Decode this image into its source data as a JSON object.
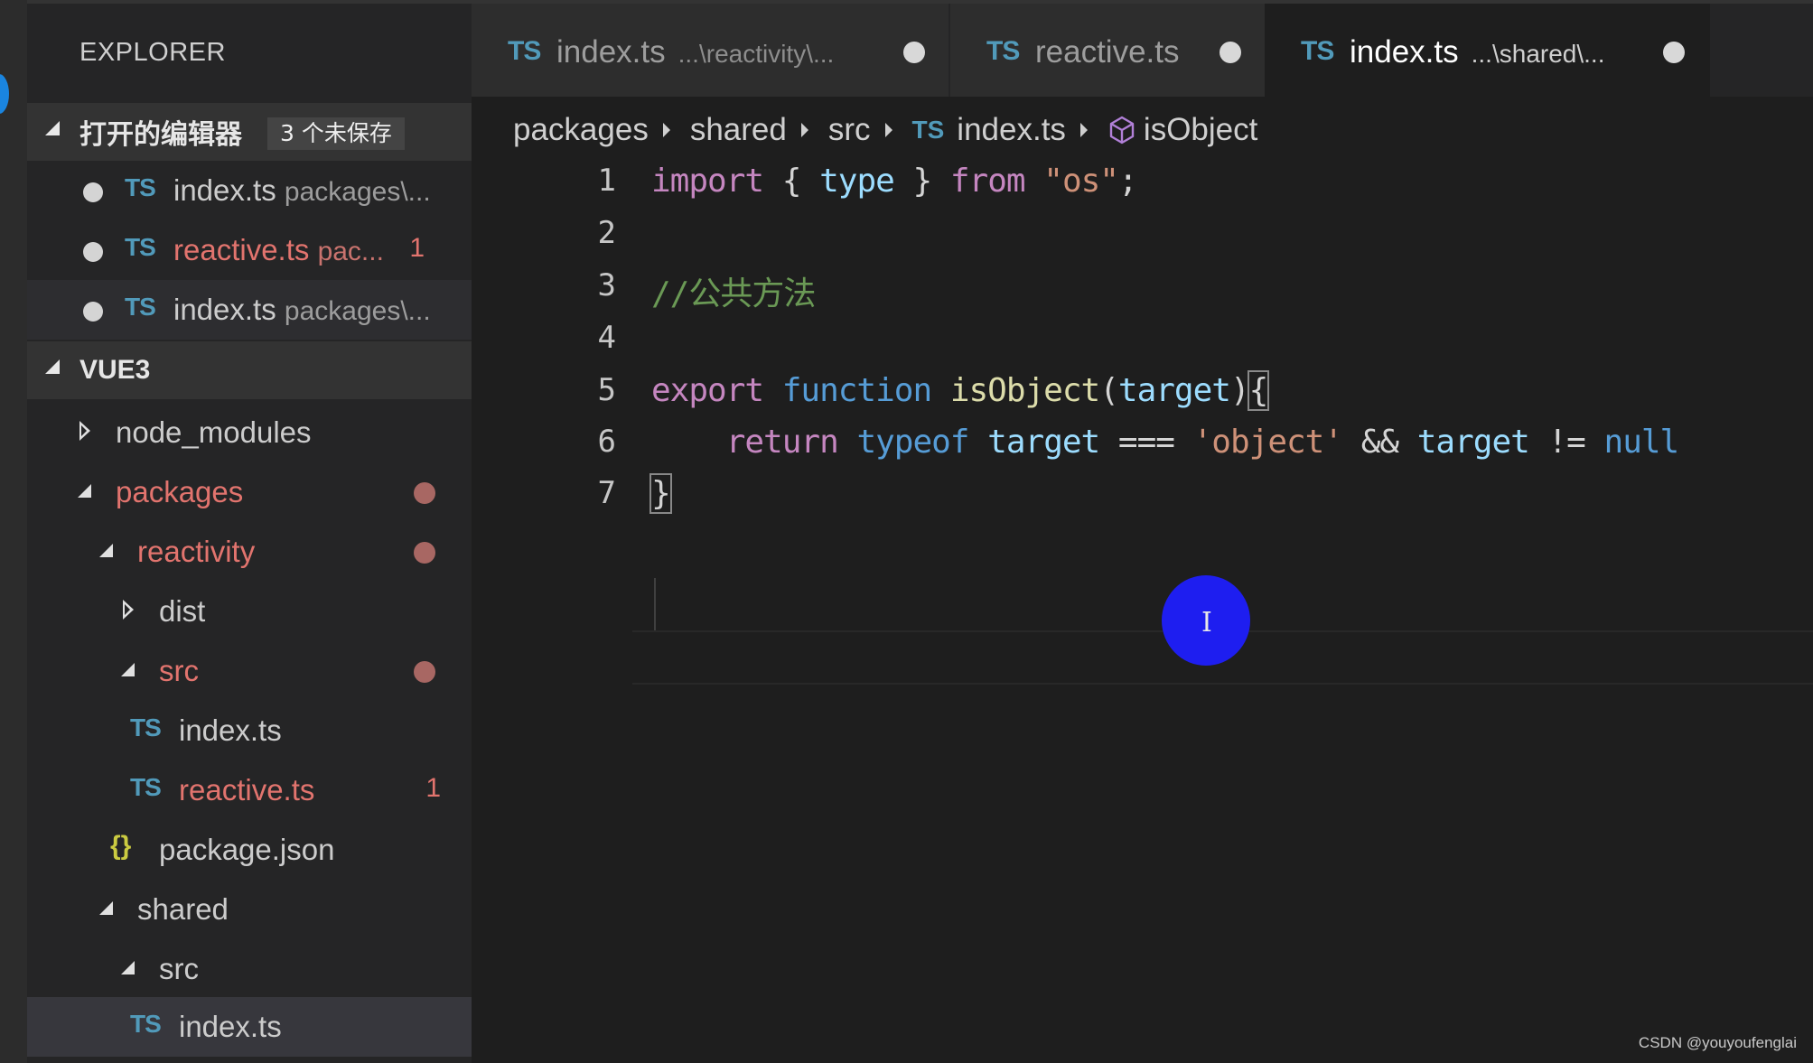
{
  "window": {
    "accent_color": "#1a85e0"
  },
  "sidebar": {
    "title": "EXPLORER",
    "open_editors": {
      "header": "打开的编辑器",
      "badge": "3 个未保存",
      "items": [
        {
          "icon": "TS",
          "name": "index.ts",
          "desc": "packages\\...",
          "dirty": true,
          "error": false,
          "count": ""
        },
        {
          "icon": "TS",
          "name": "reactive.ts",
          "desc": "pac...",
          "dirty": true,
          "error": true,
          "count": "1"
        },
        {
          "icon": "TS",
          "name": "index.ts",
          "desc": "packages\\...",
          "dirty": true,
          "error": false,
          "count": ""
        }
      ]
    },
    "workspace": {
      "header": "VUE3",
      "tree": [
        {
          "name": "node_modules",
          "type": "folder",
          "expanded": false
        },
        {
          "name": "packages",
          "type": "folder",
          "expanded": true,
          "modified": true
        },
        {
          "name": "reactivity",
          "type": "folder",
          "expanded": true,
          "modified": true
        },
        {
          "name": "dist",
          "type": "folder",
          "expanded": false
        },
        {
          "name": "src",
          "type": "folder",
          "expanded": true,
          "modified": true
        },
        {
          "icon": "TS",
          "name": "index.ts",
          "type": "file"
        },
        {
          "icon": "TS",
          "name": "reactive.ts",
          "type": "file",
          "error": true,
          "count": "1"
        },
        {
          "icon": "{}",
          "name": "package.json",
          "type": "file"
        },
        {
          "name": "shared",
          "type": "folder",
          "expanded": true
        },
        {
          "name": "src",
          "type": "folder",
          "expanded": true
        },
        {
          "icon": "TS",
          "name": "index.ts",
          "type": "file",
          "selected": true
        }
      ]
    }
  },
  "tabs": [
    {
      "icon": "TS",
      "name": "index.ts",
      "path": "...\\reactivity\\...",
      "dirty": true,
      "active": false
    },
    {
      "icon": "TS",
      "name": "reactive.ts",
      "path": "",
      "dirty": true,
      "active": false
    },
    {
      "icon": "TS",
      "name": "index.ts",
      "path": "...\\shared\\...",
      "dirty": true,
      "active": true
    }
  ],
  "breadcrumb": {
    "parts": [
      "packages",
      "shared",
      "src"
    ],
    "file_icon": "TS",
    "file": "index.ts",
    "symbol_icon": "cube-icon",
    "symbol": "isObject"
  },
  "editor": {
    "line_numbers": [
      "1",
      "2",
      "3",
      "4",
      "5",
      "6",
      "7"
    ],
    "current_line": 7,
    "lines": {
      "l1": {
        "import": "import",
        "ob": "{",
        "type": "type",
        "cb": "}",
        "from": "from",
        "str": "\"os\"",
        "semi": ";"
      },
      "l3": {
        "comment": "//公共方法"
      },
      "l5": {
        "export": "export",
        "function": "function",
        "name": "isObject",
        "po": "(",
        "param": "target",
        "pc": ")",
        "brace": "{"
      },
      "l6": {
        "return": "return",
        "typeof": "typeof",
        "target": "target",
        "op": "===",
        "str": "'object'",
        "and": "&&",
        "target2": "target",
        "neq": "!=",
        "null": "null"
      },
      "l7": {
        "brace": "}"
      }
    }
  },
  "cursor": {
    "glyph": "I"
  },
  "watermark": "CSDN @youyoufenglai"
}
